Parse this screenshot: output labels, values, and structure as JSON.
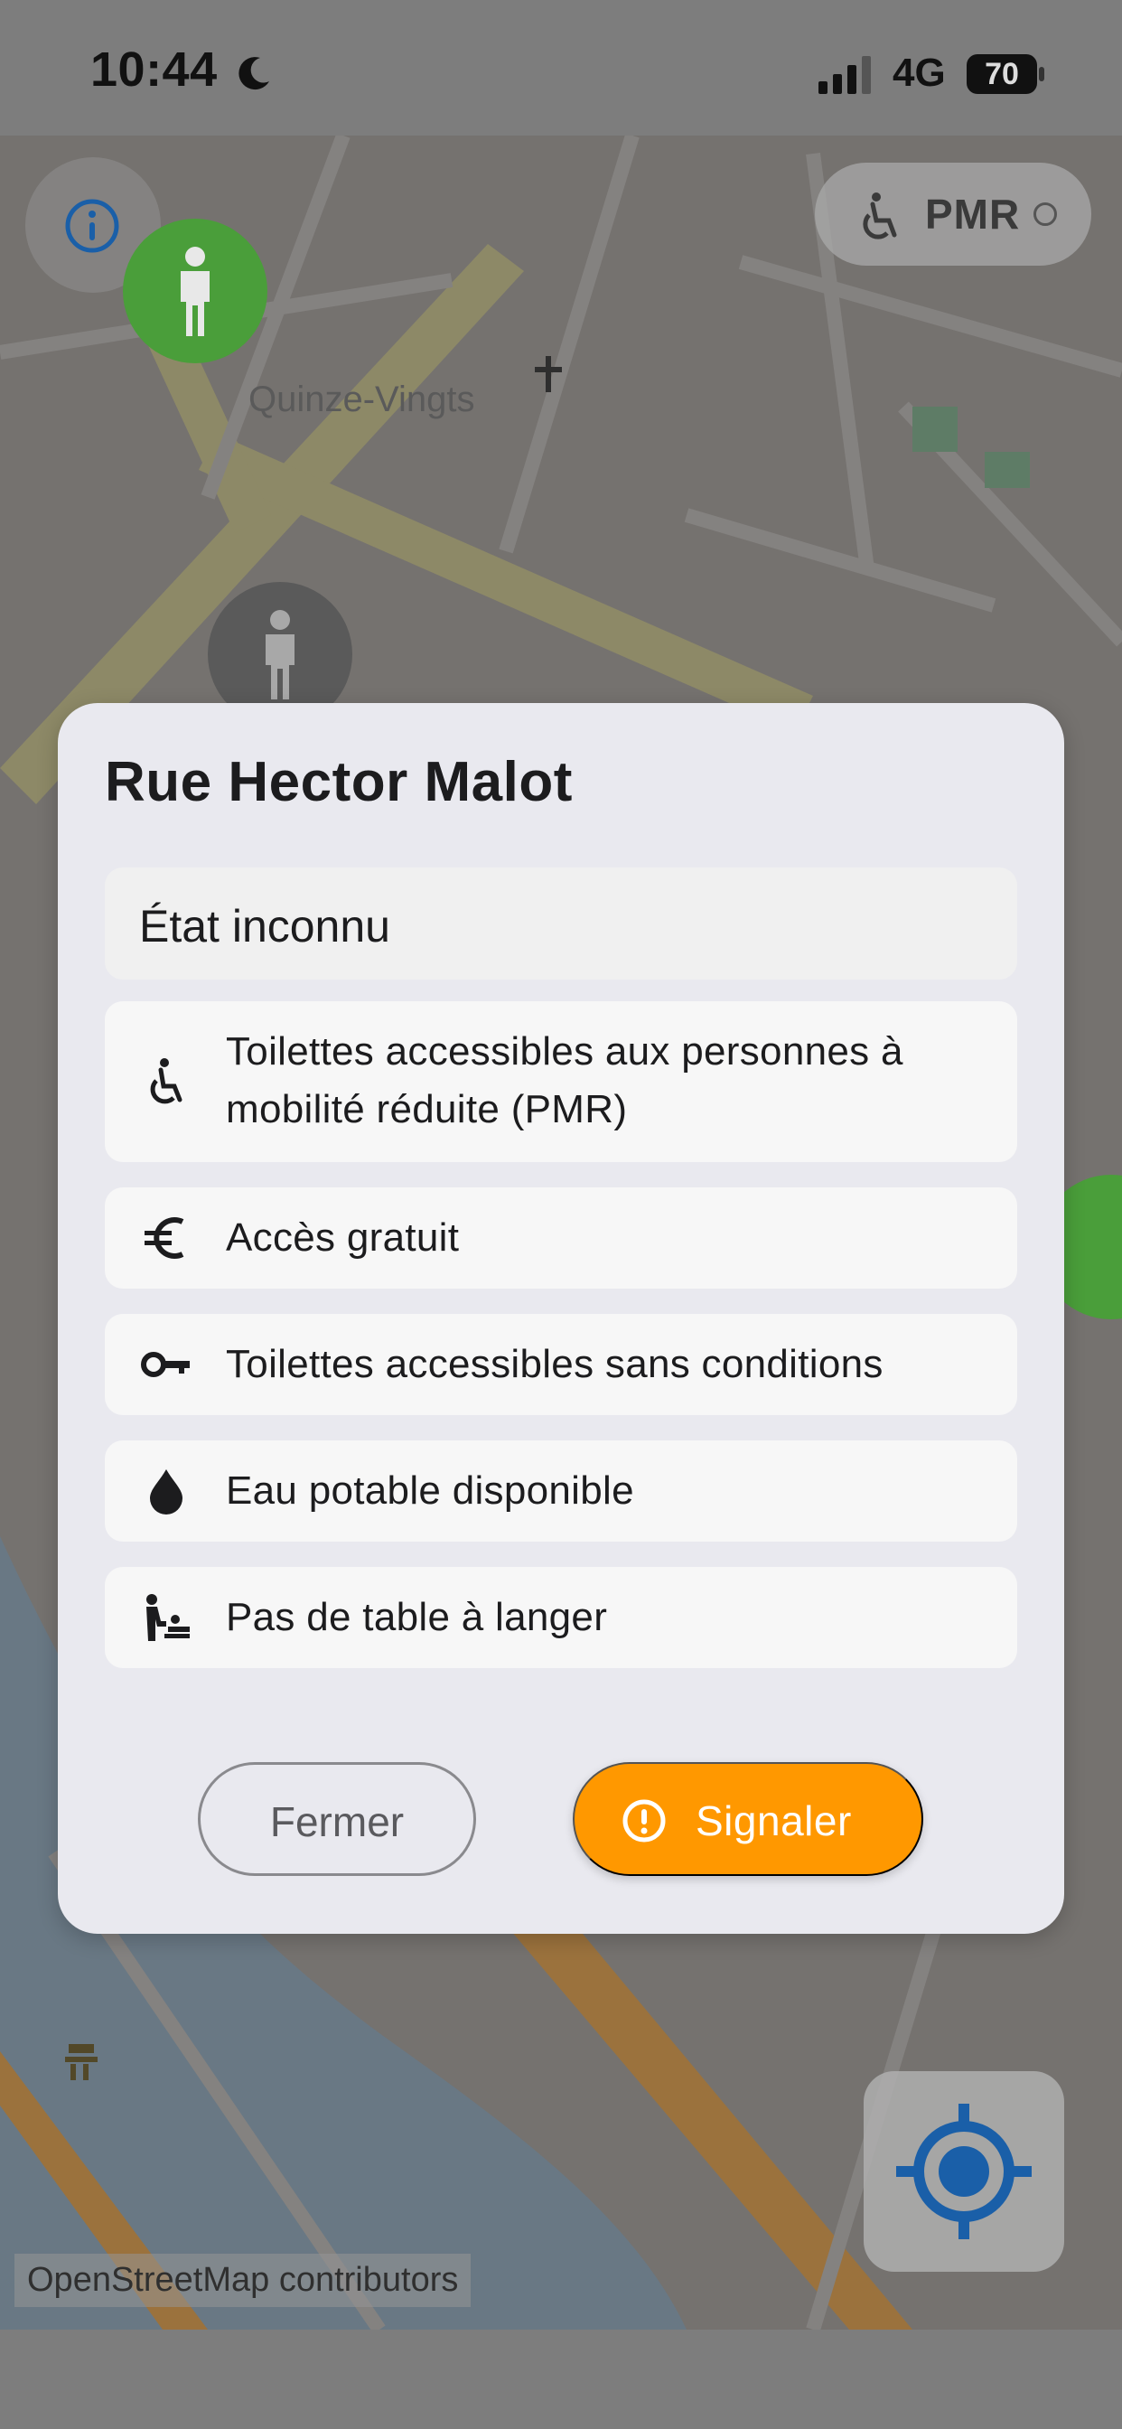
{
  "status_bar": {
    "time": "10:44",
    "network": "4G",
    "battery": "70",
    "icons": [
      "moon-icon",
      "signal-icon",
      "battery-icon"
    ]
  },
  "map": {
    "place_label": "Quinze-Vingts",
    "attribution": "OpenStreetMap contributors",
    "pmr_toggle_label": "PMR",
    "colors": {
      "marker_available": "#4a9e3a",
      "marker_unknown": "#5a5a5a",
      "locate_icon": "#1a5fa8"
    }
  },
  "dialog": {
    "title": "Rue Hector Malot",
    "status": "État inconnu",
    "features": [
      {
        "icon": "wheelchair-icon",
        "label": "Toilettes accessibles aux personnes à mobilité réduite (PMR)"
      },
      {
        "icon": "euro-icon",
        "label": "Accès gratuit"
      },
      {
        "icon": "key-icon",
        "label": "Toilettes accessibles sans conditions"
      },
      {
        "icon": "water-drop-icon",
        "label": "Eau potable disponible"
      },
      {
        "icon": "baby-changing-icon",
        "label": "Pas de table à langer"
      }
    ],
    "close_label": "Fermer",
    "report_label": "Signaler",
    "colors": {
      "report_button": "#ff9800",
      "dialog_bg": "#e9e9ef"
    }
  }
}
